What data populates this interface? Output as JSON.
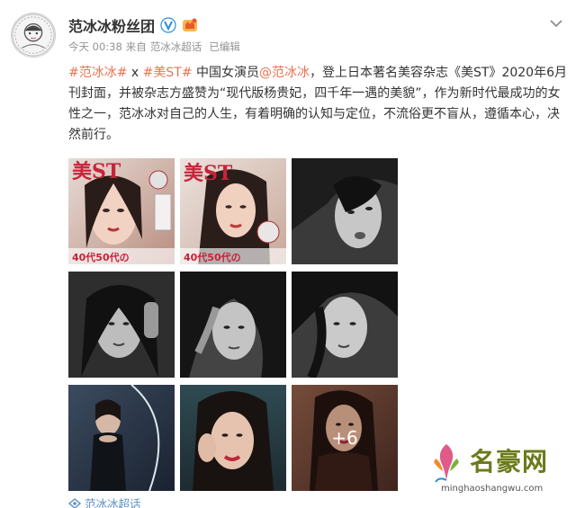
{
  "post": {
    "author": "范冰冰粉丝团",
    "time": "今天 00:38",
    "source_prefix": "来自",
    "source": "范冰冰超话",
    "edited": "已编辑",
    "text": {
      "tag1": "#范冰冰#",
      "x": " x ",
      "tag2": "#美ST#",
      "pre_mention": " 中国女演员",
      "mention": "@范冰冰",
      "body": "，登上日本著名美容杂志《美ST》2020年6月刊封面，并被杂志方盛赞为“现代版杨贵妃，四千年一遇的美貌”，作为新时代最成功的女性之一，范冰冰对自己的人生，有着明确的认知与定位，不流俗更不盲从，遵循本心，决然前行。"
    },
    "images": [
      {
        "kind": "cover",
        "title": "美ST",
        "caption": "40代50代の"
      },
      {
        "kind": "cover",
        "title": "美ST",
        "caption": "40代50代の"
      },
      {
        "kind": "bw"
      },
      {
        "kind": "bw"
      },
      {
        "kind": "bw"
      },
      {
        "kind": "bw"
      },
      {
        "kind": "color-dark"
      },
      {
        "kind": "color-portrait"
      },
      {
        "kind": "color-warm",
        "more": "+6"
      }
    ],
    "topic": "范冰冰超话"
  },
  "watermark": {
    "title": "名豪网",
    "url": "minghaoshangwu.com"
  },
  "colors": {
    "link": "#eb7350",
    "topic": "#5b8fc7",
    "meta": "#939393"
  },
  "icons": [
    "avatar-icon",
    "verified-icon",
    "vip-badge-icon",
    "chevron-down-icon",
    "topic-icon",
    "watermark-logo-icon"
  ]
}
